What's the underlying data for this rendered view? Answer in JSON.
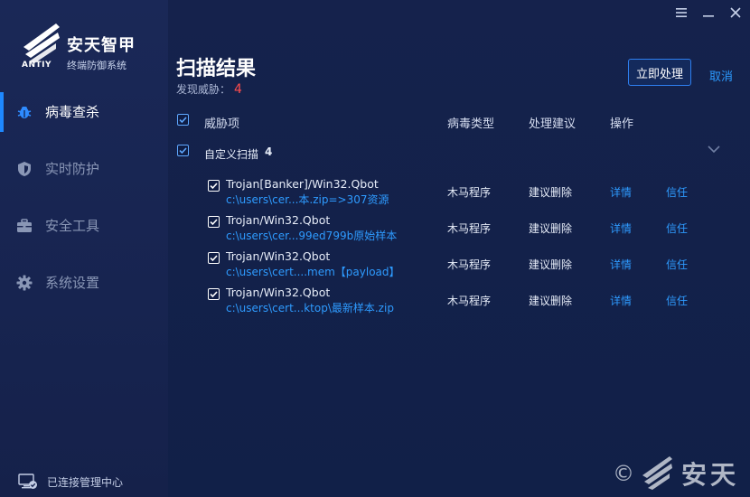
{
  "brand": {
    "name": "安天智甲",
    "subtitle": "终端防御系统",
    "latin": "ANTIY"
  },
  "nav": {
    "items": [
      {
        "label": "病毒查杀",
        "icon": "bug-icon",
        "active": true
      },
      {
        "label": "实时防护",
        "icon": "shield-icon",
        "active": false
      },
      {
        "label": "安全工具",
        "icon": "toolbox-icon",
        "active": false
      },
      {
        "label": "系统设置",
        "icon": "gear-icon",
        "active": false
      }
    ]
  },
  "status": {
    "text": "已连接管理中心",
    "icon": "monitor-check-icon"
  },
  "window": {
    "menu_icon": "menu-icon",
    "minimize_icon": "minimize-icon",
    "close_icon": "close-icon"
  },
  "page": {
    "title": "扫描结果",
    "threats_label": "发现威胁：",
    "threats_count": "4",
    "primary_action": "立即处理",
    "cancel_action": "取消"
  },
  "table": {
    "headers": {
      "threat": "威胁项",
      "virus_type": "病毒类型",
      "advice": "处理建议",
      "actions": "操作"
    },
    "group": {
      "label": "自定义扫描",
      "count": "4"
    },
    "rows": [
      {
        "name": "Trojan[Banker]/Win32.Qbot",
        "path": "c:\\users\\cer...本.zip=>307资源",
        "type": "木马程序",
        "advice": "建议删除",
        "detail": "详情",
        "trust": "信任"
      },
      {
        "name": "Trojan/Win32.Qbot",
        "path": "c:\\users\\cer...99ed799b原始样本",
        "type": "木马程序",
        "advice": "建议删除",
        "detail": "详情",
        "trust": "信任"
      },
      {
        "name": "Trojan/Win32.Qbot",
        "path": "c:\\users\\cert....mem【payload】",
        "type": "木马程序",
        "advice": "建议删除",
        "detail": "详情",
        "trust": "信任"
      },
      {
        "name": "Trojan/Win32.Qbot",
        "path": "c:\\users\\cert...ktop\\最新样本.zip",
        "type": "木马程序",
        "advice": "建议删除",
        "detail": "详情",
        "trust": "信任"
      }
    ]
  },
  "watermark": {
    "symbol": "©",
    "text": "安天"
  },
  "colors": {
    "accent": "#2e9bff",
    "danger": "#ff4d4d",
    "background": "#112048"
  }
}
